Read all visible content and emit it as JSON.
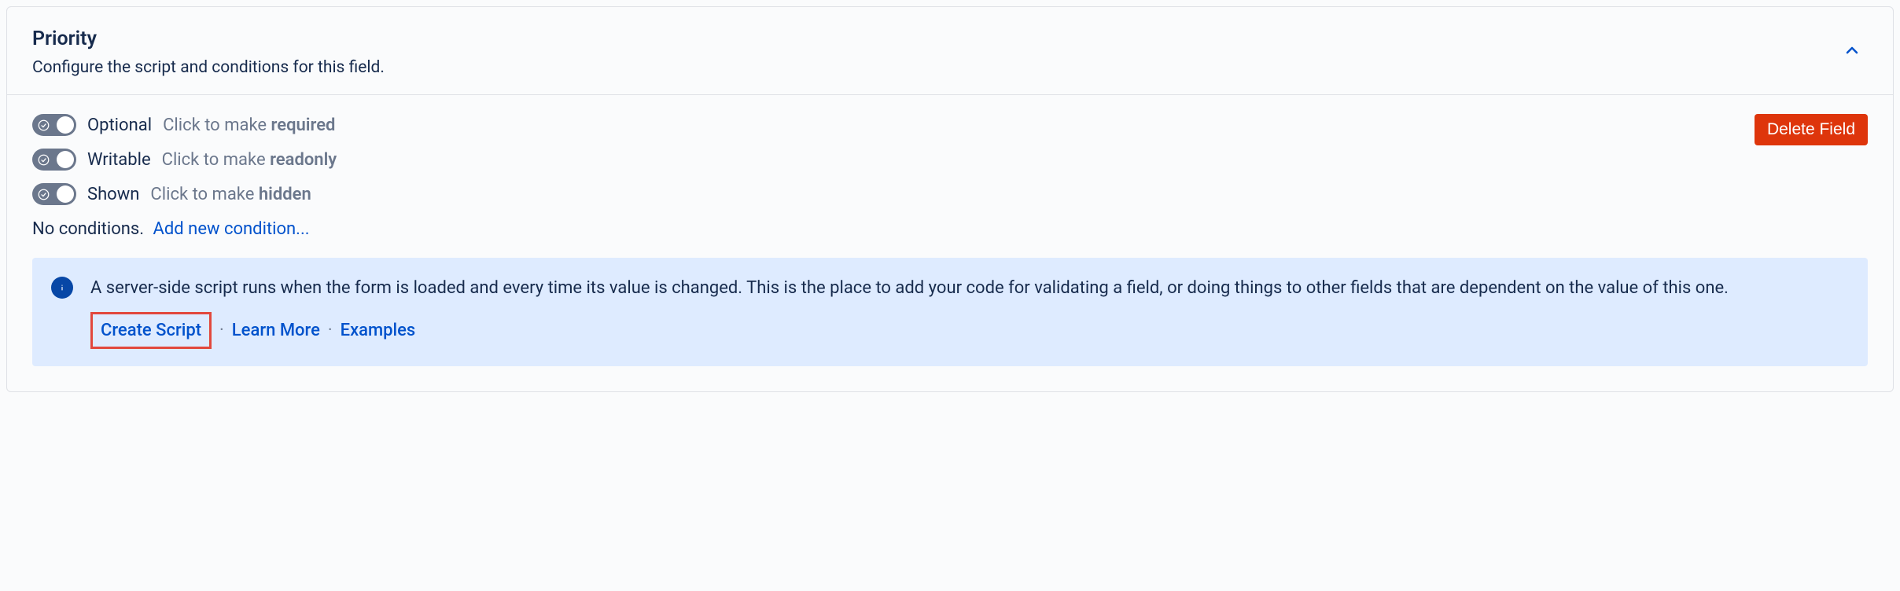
{
  "panel": {
    "title": "Priority",
    "subtitle": "Configure the script and conditions for this field.",
    "delete_label": "Delete Field"
  },
  "toggles": [
    {
      "label": "Optional",
      "hint_prefix": "Click to make ",
      "hint_bold": "required"
    },
    {
      "label": "Writable",
      "hint_prefix": "Click to make ",
      "hint_bold": "readonly"
    },
    {
      "label": "Shown",
      "hint_prefix": "Click to make ",
      "hint_bold": "hidden"
    }
  ],
  "conditions": {
    "text": "No conditions.",
    "link": "Add new condition..."
  },
  "info": {
    "text": "A server-side script runs when the form is loaded and every time its value is changed. This is the place to add your code for validating a field, or doing things to other fields that are dependent on the value of this one.",
    "create_script": "Create Script",
    "learn_more": "Learn More",
    "examples": "Examples"
  }
}
